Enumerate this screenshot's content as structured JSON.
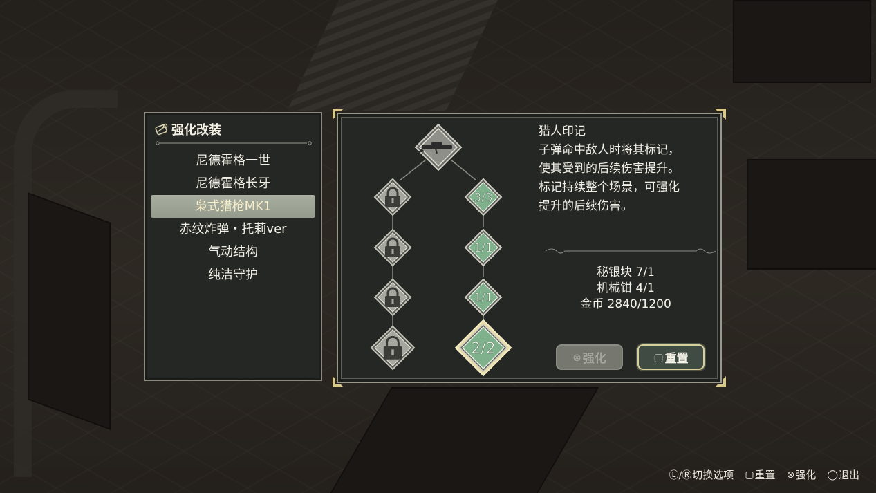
{
  "list": {
    "title": "强化改装",
    "items": [
      {
        "label": "尼德霍格一世",
        "selected": false
      },
      {
        "label": "尼德霍格长牙",
        "selected": false
      },
      {
        "label": "枭式猎枪MK1",
        "selected": true
      },
      {
        "label": "赤纹炸弹・托莉ver",
        "selected": false
      },
      {
        "label": "气动结构",
        "selected": false
      },
      {
        "label": "纯洁守护",
        "selected": false
      }
    ]
  },
  "tree": {
    "root_icon": "rifle-icon",
    "left_column": [
      "lock-icon",
      "lock-icon",
      "lock-icon",
      "lock-icon"
    ],
    "right_column": [
      "3/3",
      "1/1",
      "1/1",
      "2/2"
    ]
  },
  "detail": {
    "title": "猎人印记",
    "description": "子弹命中敌人时将其标记，\n使其受到的后续伤害提升。\n标记持续整个场景，可强化\n提升的后续伤害。"
  },
  "costs": [
    "秘银块 7/1",
    "机械钳 4/1",
    "金币 2840/1200"
  ],
  "buttons": {
    "enhance": {
      "glyph": "⊗",
      "label": "强化"
    },
    "reset": {
      "glyph": "▢",
      "label": "重置"
    }
  },
  "footer": {
    "switch": {
      "glyph": "Ⓛ/Ⓡ",
      "label": "切换选项"
    },
    "reset": {
      "glyph": "▢",
      "label": "重置"
    },
    "enhance": {
      "glyph": "⊗",
      "label": "强化"
    },
    "exit": {
      "glyph": "◯",
      "label": "退出"
    }
  },
  "colors": {
    "panel_bg": "#242723",
    "selected_bg": "#a7ad9f",
    "unlocked_green": "#7fb18c",
    "gold_border": "#d8cf9b"
  }
}
